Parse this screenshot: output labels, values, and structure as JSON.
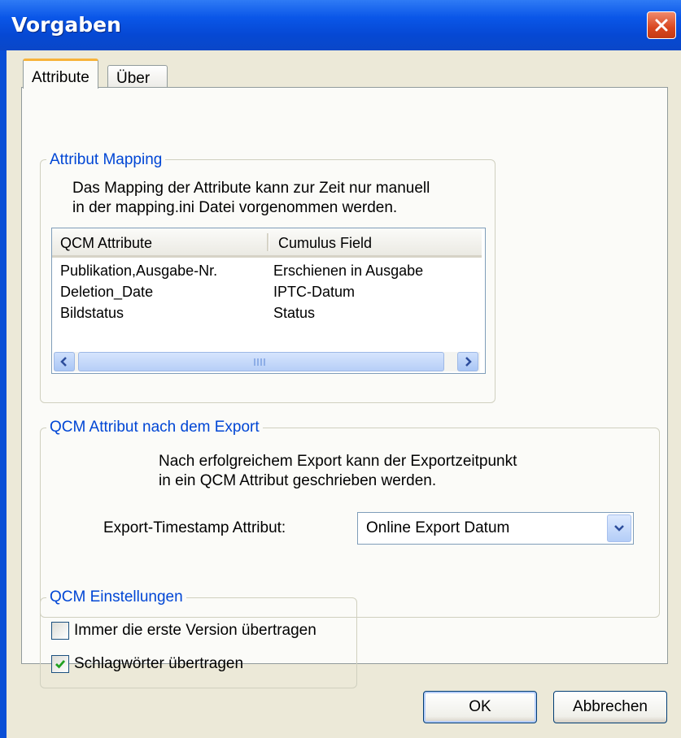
{
  "window": {
    "title": "Vorgaben"
  },
  "tabs": [
    {
      "label": "Attribute",
      "active": true
    },
    {
      "label": "Über",
      "active": false
    }
  ],
  "attribut_mapping": {
    "legend": "Attribut Mapping",
    "description_line1": "Das Mapping der Attribute kann zur Zeit nur manuell",
    "description_line2": "in der mapping.ini Datei vorgenommen werden.",
    "columns": [
      "QCM Attribute",
      "Cumulus Field"
    ],
    "rows": [
      [
        "Publikation,Ausgabe-Nr.",
        "Erschienen in Ausgabe"
      ],
      [
        "Deletion_Date",
        "IPTC-Datum"
      ],
      [
        "Bildstatus",
        "Status"
      ]
    ]
  },
  "export_section": {
    "legend": "QCM Attribut nach dem Export",
    "description_line1": "Nach erfolgreichem Export kann der Exportzeitpunkt",
    "description_line2": "in ein QCM Attribut geschrieben werden.",
    "field_label": "Export-Timestamp Attribut:",
    "selected_value": "Online Export Datum"
  },
  "einstellungen": {
    "legend": "QCM Einstellungen",
    "options": [
      {
        "label": "Immer die erste Version übertragen",
        "checked": false
      },
      {
        "label": "Schlagwörter übertragen",
        "checked": true
      }
    ]
  },
  "buttons": {
    "ok": "OK",
    "cancel": "Abbrechen"
  },
  "icons": {
    "close": "close-icon",
    "dropdown": "chevron-down-icon",
    "scroll_left": "arrow-left-icon",
    "scroll_right": "arrow-right-icon",
    "check": "checkmark-icon"
  }
}
